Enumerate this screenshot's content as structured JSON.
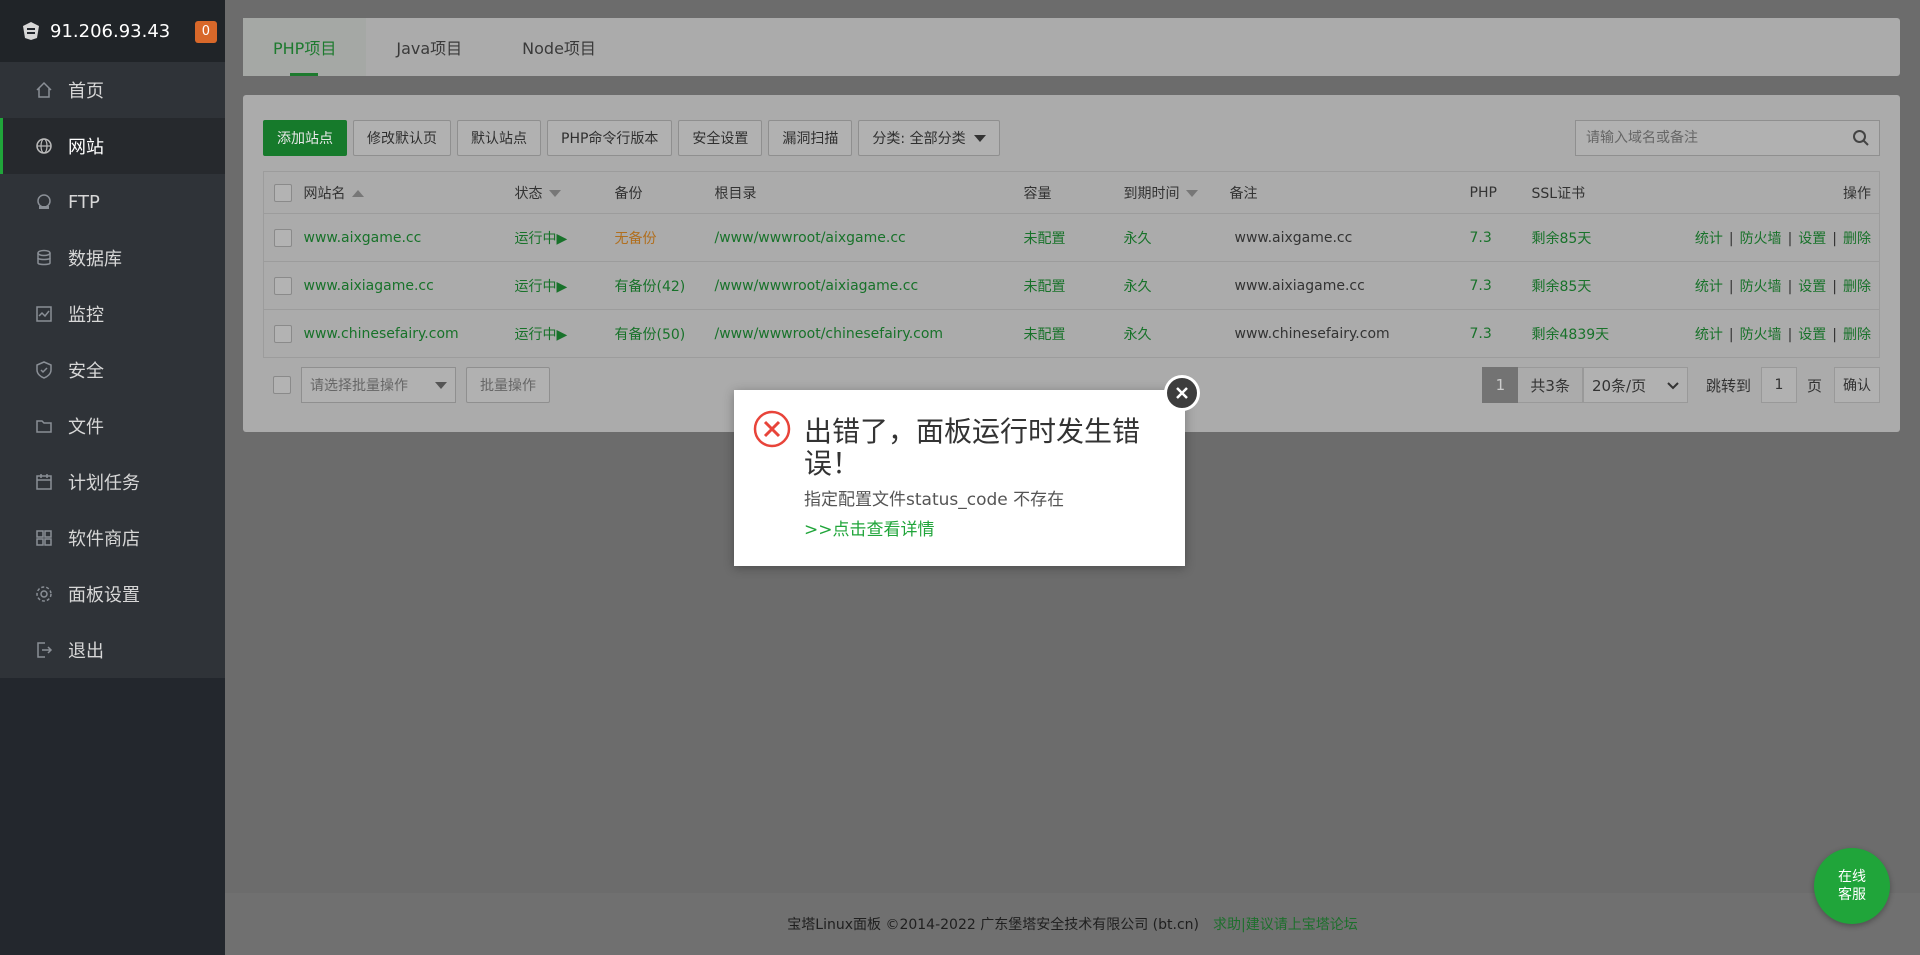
{
  "sidebar": {
    "server_ip": "91.206.93.43",
    "badge_count": "0",
    "items": [
      {
        "label": "首页",
        "icon": "home-icon"
      },
      {
        "label": "网站",
        "icon": "globe-icon",
        "active": true
      },
      {
        "label": "FTP",
        "icon": "ftp-icon"
      },
      {
        "label": "数据库",
        "icon": "database-icon"
      },
      {
        "label": "监控",
        "icon": "monitor-icon"
      },
      {
        "label": "安全",
        "icon": "shield-icon"
      },
      {
        "label": "文件",
        "icon": "folder-icon"
      },
      {
        "label": "计划任务",
        "icon": "calendar-icon"
      },
      {
        "label": "软件商店",
        "icon": "apps-icon"
      },
      {
        "label": "面板设置",
        "icon": "gear-icon"
      },
      {
        "label": "退出",
        "icon": "logout-icon"
      }
    ]
  },
  "tabs": [
    "PHP项目",
    "Java项目",
    "Node项目"
  ],
  "toolbar": {
    "add_site": "添加站点",
    "modify_default_page": "修改默认页",
    "default_site": "默认站点",
    "php_cli_version": "PHP命令行版本",
    "security_settings": "安全设置",
    "vuln_scan": "漏洞扫描",
    "category": "分类: 全部分类"
  },
  "search": {
    "placeholder": "请输入域名或备注"
  },
  "table": {
    "headers": {
      "name": "网站名",
      "status": "状态",
      "backup": "备份",
      "root": "根目录",
      "quota": "容量",
      "expire": "到期时间",
      "remark": "备注",
      "php": "PHP",
      "ssl": "SSL证书",
      "ops": "操作"
    },
    "rows": [
      {
        "name": "www.aixgame.cc",
        "status": "运行中▶",
        "backup": "无备份",
        "root": "/www/wwwroot/aixgame.cc",
        "quota": "未配置",
        "expire": "永久",
        "remark": "www.aixgame.cc",
        "php": "7.3",
        "ssl": "剩余85天"
      },
      {
        "name": "www.aixiagame.cc",
        "status": "运行中▶",
        "backup": "有备份(42)",
        "root": "/www/wwwroot/aixiagame.cc",
        "quota": "未配置",
        "expire": "永久",
        "remark": "www.aixiagame.cc",
        "php": "7.3",
        "ssl": "剩余85天"
      },
      {
        "name": "www.chinesefairy.com",
        "status": "运行中▶",
        "backup": "有备份(50)",
        "root": "/www/wwwroot/chinesefairy.com",
        "quota": "未配置",
        "expire": "永久",
        "remark": "www.chinesefairy.com",
        "php": "7.3",
        "ssl": "剩余4839天"
      }
    ],
    "ops": {
      "stats": "统计",
      "firewall": "防火墙",
      "settings": "设置",
      "delete": "删除"
    }
  },
  "batch": {
    "select_placeholder": "请选择批量操作",
    "button": "批量操作"
  },
  "pager": {
    "current": "1",
    "total": "共3条",
    "page_size": "20条/页",
    "jump_label": "跳转到",
    "jump_value": "1",
    "page_unit": "页",
    "confirm": "确认"
  },
  "footer": {
    "copyright": "宝塔Linux面板 ©2014-2022 广东堡塔安全技术有限公司 (bt.cn)",
    "forum_link": "求助|建议请上宝塔论坛"
  },
  "chat": {
    "line1": "在线",
    "line2": "客服"
  },
  "dialog": {
    "title": "出错了，面板运行时发生错误！",
    "message": "指定配置文件status_code 不存在",
    "link": ">>点击查看详情"
  },
  "colors": {
    "accent": "#20a53a",
    "error": "#e8443a",
    "badge": "#d8682a"
  }
}
